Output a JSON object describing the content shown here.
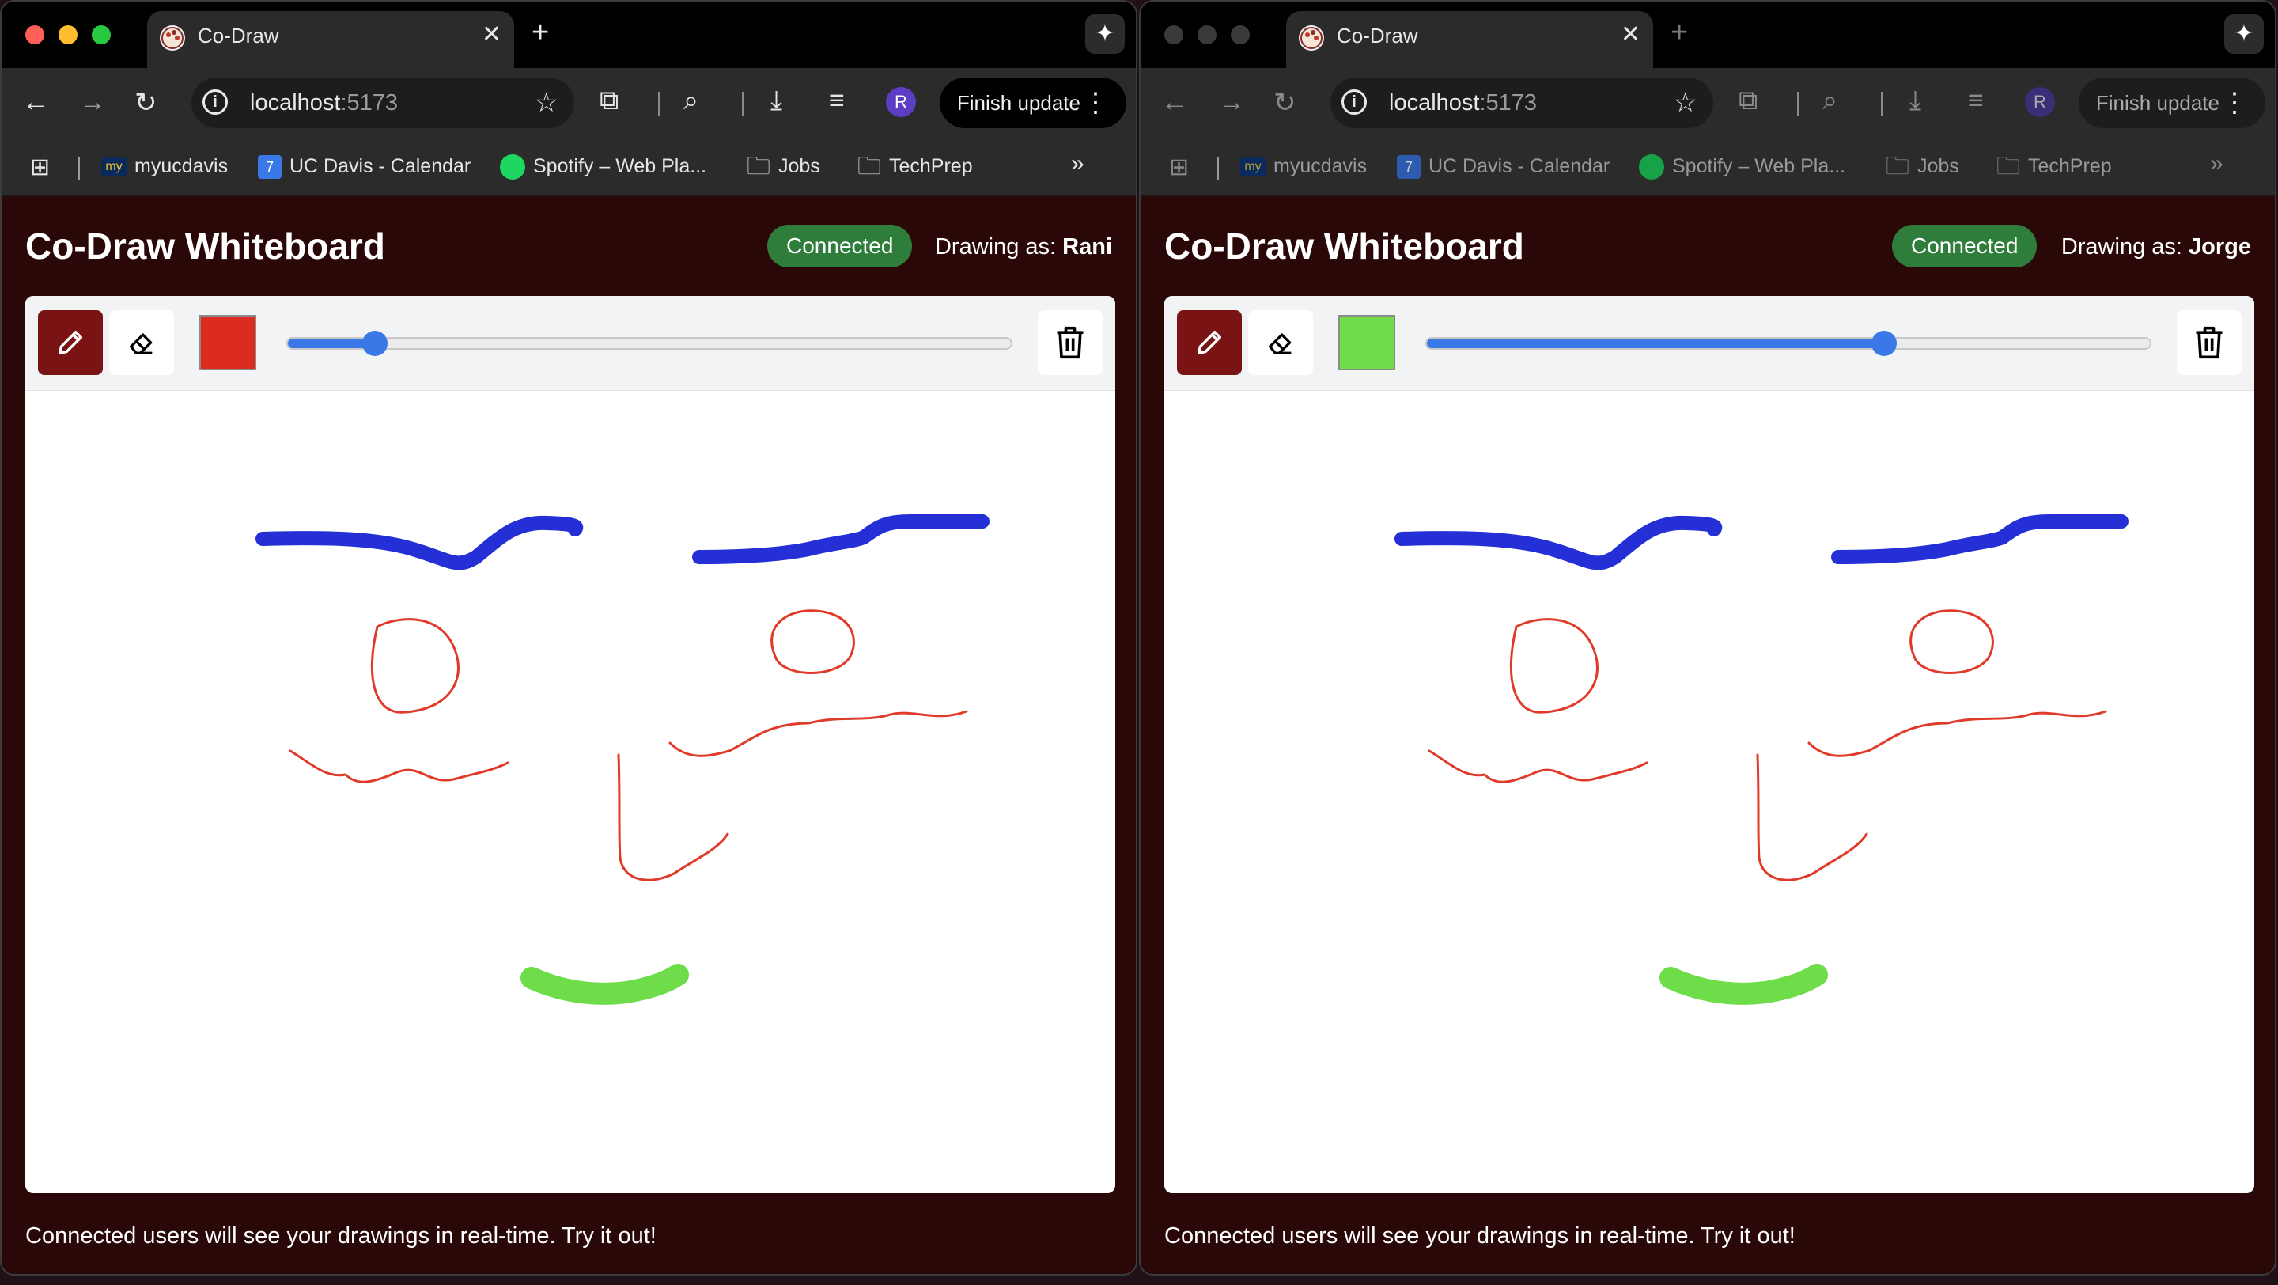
{
  "screens": [
    {
      "tab": {
        "title": "Co-Draw"
      },
      "omnibox": {
        "host": "localhost",
        "port": ":5173"
      },
      "profile_initial": "R",
      "update_label": "Finish update",
      "bookmarks": [
        {
          "label": "myucdavis",
          "icon": "myucdavis-icon"
        },
        {
          "label": "UC Davis - Calendar",
          "icon": "calendar-icon"
        },
        {
          "label": "Spotify – Web Pla...",
          "icon": "spotify-icon"
        },
        {
          "label": "Jobs",
          "icon": "folder-icon"
        },
        {
          "label": "TechPrep",
          "icon": "folder-icon"
        }
      ],
      "app": {
        "title": "Co-Draw Whiteboard",
        "status": "Connected",
        "drawing_as_label": "Drawing as:",
        "user": "Rani",
        "brush_color": "#dc2c22",
        "brush_size_fraction": 0.12,
        "footer": "Connected users will see your drawings in real-time. Try it out!"
      }
    },
    {
      "tab": {
        "title": "Co-Draw"
      },
      "omnibox": {
        "host": "localhost",
        "port": ":5173"
      },
      "profile_initial": "R",
      "update_label": "Finish update",
      "bookmarks": [
        {
          "label": "myucdavis",
          "icon": "myucdavis-icon"
        },
        {
          "label": "UC Davis - Calendar",
          "icon": "calendar-icon"
        },
        {
          "label": "Spotify – Web Pla...",
          "icon": "spotify-icon"
        },
        {
          "label": "Jobs",
          "icon": "folder-icon"
        },
        {
          "label": "TechPrep",
          "icon": "folder-icon"
        }
      ],
      "app": {
        "title": "Co-Draw Whiteboard",
        "status": "Connected",
        "drawing_as_label": "Drawing as:",
        "user": "Jorge",
        "brush_color": "#6fdc4a",
        "brush_size_fraction": 0.63,
        "footer": "Connected users will see your drawings in real-time. Try it out!"
      }
    }
  ],
  "colors": {
    "stroke_blue": "#2430d6",
    "stroke_red": "#e03a2a",
    "stroke_green": "#6fdc4a",
    "accent_dark_red": "#7a1414",
    "status_green": "#2f7d3a"
  }
}
